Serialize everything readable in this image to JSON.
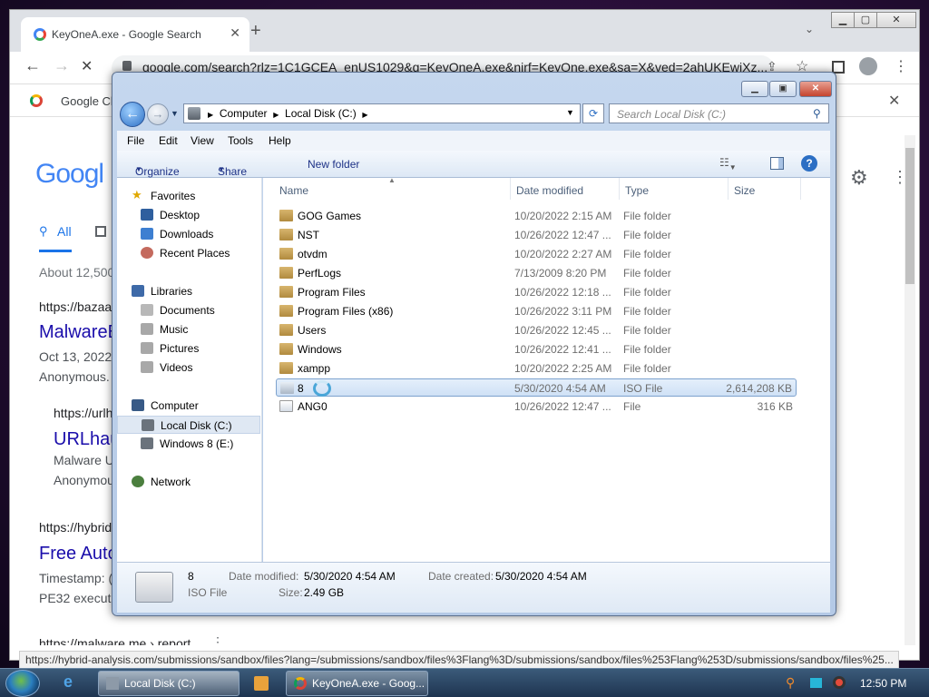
{
  "chrome": {
    "tab_title": "KeyOneA.exe - Google Search",
    "new_tab": "+",
    "url": "google.com/search?rlz=1C1GCEA_enUS1029&q=KeyOneA.exe&nirf=KeyOne.exe&sa=X&ved=2ahUKEwiXz...",
    "bookmark": "Google Cl",
    "status_url": "https://hybrid-analysis.com/submissions/sandbox/files?lang=/submissions/sandbox/files%3Flang%3D/submissions/sandbox/files%253Flang%253D/submissions/sandbox/files%25..."
  },
  "google": {
    "logo": "Googl",
    "tab_all": "All",
    "about": "About 12,500",
    "results": [
      {
        "url": "https://bazaa",
        "title": "MalwareB",
        "meta": "Oct 13, 2022",
        "snippet": "Anonymous."
      },
      {
        "url": "https://urlh",
        "title": "URLhau",
        "meta": "Malware U",
        "snippet": "Anonymou"
      },
      {
        "url": "https://hybrid",
        "title": "Free Auto",
        "meta": "Timestamp: (",
        "snippet": "PE32 executa"
      },
      {
        "url": "https://malware.me › report"
      }
    ]
  },
  "explorer": {
    "breadcrumb": [
      "Computer",
      "Local Disk (C:)"
    ],
    "search_placeholder": "Search Local Disk (C:)",
    "menu": [
      "File",
      "Edit",
      "View",
      "Tools",
      "Help"
    ],
    "commands": {
      "organize": "Organize",
      "share": "Share with",
      "new_folder": "New folder"
    },
    "nav": {
      "favorites": "Favorites",
      "desktop": "Desktop",
      "downloads": "Downloads",
      "recent": "Recent Places",
      "libraries": "Libraries",
      "documents": "Documents",
      "music": "Music",
      "pictures": "Pictures",
      "videos": "Videos",
      "computer": "Computer",
      "local_disk": "Local Disk (C:)",
      "windows8": "Windows 8 (E:)",
      "network": "Network"
    },
    "columns": {
      "name": "Name",
      "date": "Date modified",
      "type": "Type",
      "size": "Size"
    },
    "rows": [
      {
        "name": "GOG Games",
        "date": "10/20/2022 2:15 AM",
        "type": "File folder",
        "size": ""
      },
      {
        "name": "NST",
        "date": "10/26/2022 12:47 ...",
        "type": "File folder",
        "size": ""
      },
      {
        "name": "otvdm",
        "date": "10/20/2022 2:27 AM",
        "type": "File folder",
        "size": ""
      },
      {
        "name": "PerfLogs",
        "date": "7/13/2009 8:20 PM",
        "type": "File folder",
        "size": ""
      },
      {
        "name": "Program Files",
        "date": "10/26/2022 12:18 ...",
        "type": "File folder",
        "size": ""
      },
      {
        "name": "Program Files (x86)",
        "date": "10/26/2022 3:11 PM",
        "type": "File folder",
        "size": ""
      },
      {
        "name": "Users",
        "date": "10/26/2022 12:45 ...",
        "type": "File folder",
        "size": ""
      },
      {
        "name": "Windows",
        "date": "10/26/2022 12:41 ...",
        "type": "File folder",
        "size": ""
      },
      {
        "name": "xampp",
        "date": "10/20/2022 2:25 AM",
        "type": "File folder",
        "size": ""
      },
      {
        "name": "8",
        "date": "5/30/2020 4:54 AM",
        "type": "ISO File",
        "size": "2,614,208 KB"
      },
      {
        "name": "ANG0",
        "date": "10/26/2022 12:47 ...",
        "type": "File",
        "size": "316 KB"
      }
    ],
    "details": {
      "name": "8",
      "type": "ISO File",
      "modified_label": "Date modified:",
      "modified": "5/30/2020 4:54 AM",
      "created_label": "Date created:",
      "created": "5/30/2020 4:54 AM",
      "size_label": "Size:",
      "size": "2.49 GB"
    }
  },
  "taskbar": {
    "explorer_task": "Local Disk (C:)",
    "chrome_task": "KeyOneA.exe - Goog...",
    "clock": "12:50 PM"
  }
}
